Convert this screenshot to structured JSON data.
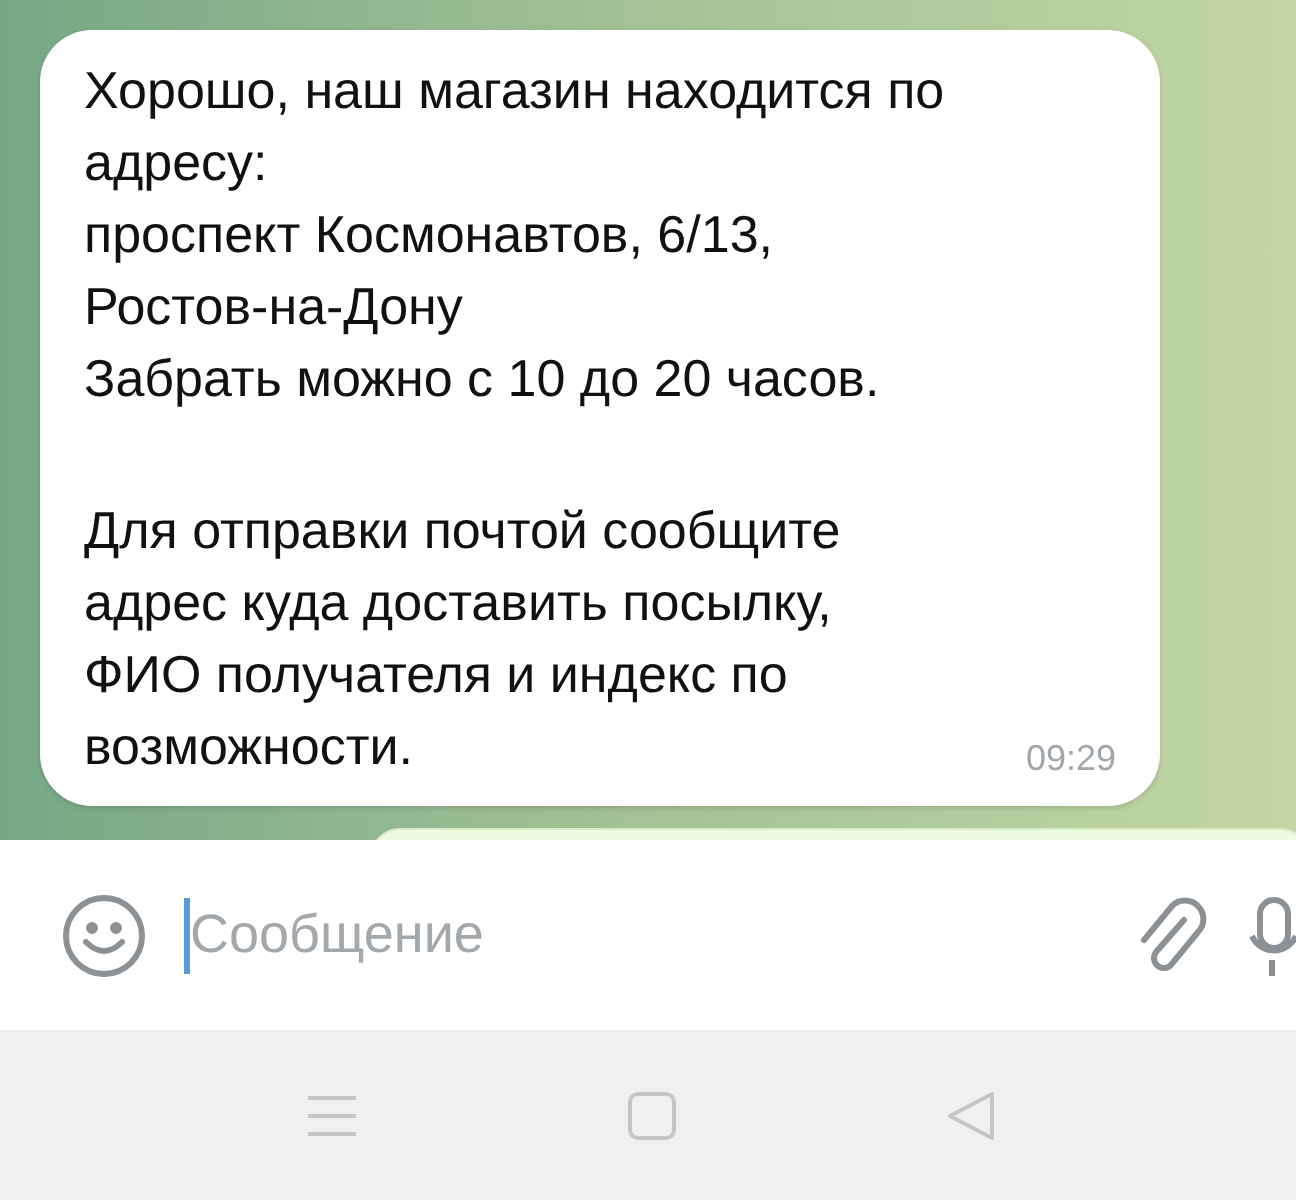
{
  "message": {
    "paragraphs": [
      "Хорошо, наш магазин находится по\nадресу:\nпроспект Космонавтов, 6/13,\nРостов-на-Дону\nЗабрать можно с 10 до 20 часов.",
      "Для отправки почтой сообщите\nадрес куда доставить посылку,\nФИО получателя и индекс по\nвозможности."
    ],
    "time": "09:29"
  },
  "composer": {
    "placeholder": "Сообщение"
  }
}
